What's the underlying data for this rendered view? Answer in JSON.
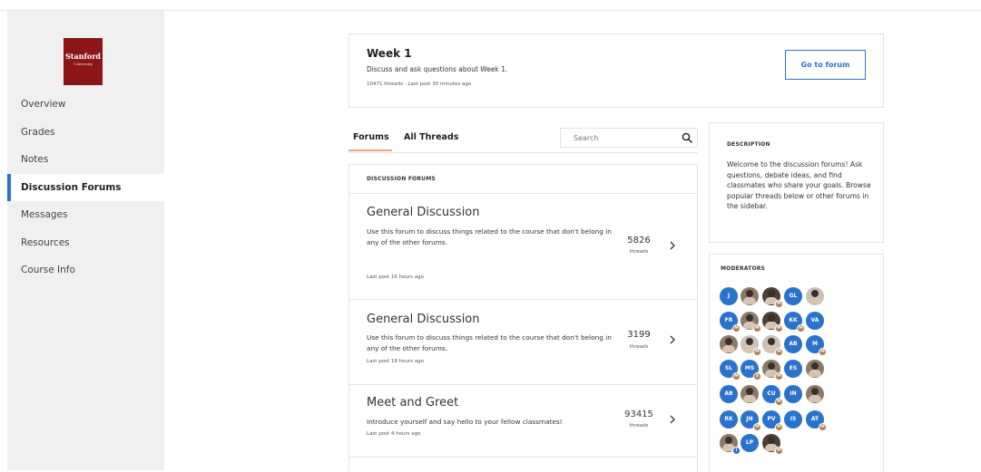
{
  "colors": {
    "accent": "#2a73cc",
    "brand": "#8c1515",
    "tab_underline": "#e8a380",
    "moderator_badge": "#b07c4f"
  },
  "logo": {
    "line1": "Stanford",
    "line2": "University"
  },
  "sidebar": {
    "items": [
      {
        "label": "Overview"
      },
      {
        "label": "Grades"
      },
      {
        "label": "Notes"
      },
      {
        "label": "Discussion Forums",
        "active": true
      },
      {
        "label": "Messages"
      },
      {
        "label": "Resources"
      },
      {
        "label": "Course Info"
      }
    ]
  },
  "week": {
    "title": "Week 1",
    "description": "Discuss and ask questions about Week 1.",
    "meta": "10471 threads · Last post 30 minutes ago",
    "button_label": "Go to forum"
  },
  "tabs": {
    "forums": "Forums",
    "all_threads": "All Threads"
  },
  "search": {
    "placeholder": "Search",
    "icon": "search-icon"
  },
  "forum_list": {
    "header": "DISCUSSION FORUMS",
    "items": [
      {
        "title": "General Discussion",
        "description": "Use this forum to discuss things related to the course that don't belong in any of the other forums.",
        "last_post": "Last post 16 hours ago",
        "count": "5826",
        "unit": "threads"
      },
      {
        "title": "General Discussion",
        "description": "Use this forum to discuss things related to the course that don't belong in any of the other forums.",
        "last_post": "Last post 18 hours ago",
        "count": "3199",
        "unit": "threads"
      },
      {
        "title": "Meet and Greet",
        "description": "Introduce yourself and say hello to your fellow classmates!",
        "last_post": "Last post 4 hours ago",
        "count": "93415",
        "unit": "threads"
      }
    ]
  },
  "description_panel": {
    "heading": "DESCRIPTION",
    "text": "Welcome to the discussion forums! Ask questions, debate ideas, and find classmates who share your goals. Browse popular threads below or other forums in the sidebar."
  },
  "moderators": {
    "heading": "MODERATORS",
    "avatars": [
      {
        "initials": "J",
        "kind": "init",
        "badge": ""
      },
      {
        "initials": "",
        "kind": "photo",
        "badge": ""
      },
      {
        "initials": "",
        "kind": "photo",
        "tone": "dark",
        "badge": "M"
      },
      {
        "initials": "GL",
        "kind": "init",
        "badge": ""
      },
      {
        "initials": "",
        "kind": "photo",
        "tone": "light",
        "badge": ""
      },
      {
        "initials": "FR",
        "kind": "init",
        "badge": "M"
      },
      {
        "initials": "",
        "kind": "photo",
        "badge": "M"
      },
      {
        "initials": "",
        "kind": "photo",
        "tone": "dark",
        "badge": "M"
      },
      {
        "initials": "KK",
        "kind": "init",
        "badge": "M"
      },
      {
        "initials": "VA",
        "kind": "init",
        "badge": ""
      },
      {
        "initials": "",
        "kind": "photo",
        "badge": ""
      },
      {
        "initials": "",
        "kind": "photo",
        "tone": "light",
        "badge": "M"
      },
      {
        "initials": "",
        "kind": "photo",
        "tone": "light",
        "badge": "M"
      },
      {
        "initials": "AB",
        "kind": "init",
        "badge": ""
      },
      {
        "initials": "M",
        "kind": "init",
        "badge": "M"
      },
      {
        "initials": "SL",
        "kind": "init",
        "badge": "M"
      },
      {
        "initials": "MS",
        "kind": "init",
        "badge": "S"
      },
      {
        "initials": "",
        "kind": "photo",
        "badge": "M"
      },
      {
        "initials": "ES",
        "kind": "init",
        "badge": ""
      },
      {
        "initials": "",
        "kind": "photo",
        "badge": ""
      },
      {
        "initials": "AB",
        "kind": "init",
        "badge": ""
      },
      {
        "initials": "",
        "kind": "photo",
        "badge": ""
      },
      {
        "initials": "CU",
        "kind": "init",
        "badge": "M"
      },
      {
        "initials": "IN",
        "kind": "init",
        "badge": ""
      },
      {
        "initials": "",
        "kind": "photo",
        "badge": ""
      },
      {
        "initials": "RK",
        "kind": "init",
        "badge": ""
      },
      {
        "initials": "JN",
        "kind": "init",
        "badge": "M"
      },
      {
        "initials": "PV",
        "kind": "init",
        "badge": "M"
      },
      {
        "initials": "IS",
        "kind": "init",
        "badge": ""
      },
      {
        "initials": "AT",
        "kind": "init",
        "badge": "M"
      },
      {
        "initials": "",
        "kind": "photo",
        "badge": "I",
        "badge_color": "blue"
      },
      {
        "initials": "LP",
        "kind": "init",
        "badge": ""
      },
      {
        "initials": "",
        "kind": "photo",
        "tone": "dark",
        "badge": "M"
      }
    ]
  }
}
